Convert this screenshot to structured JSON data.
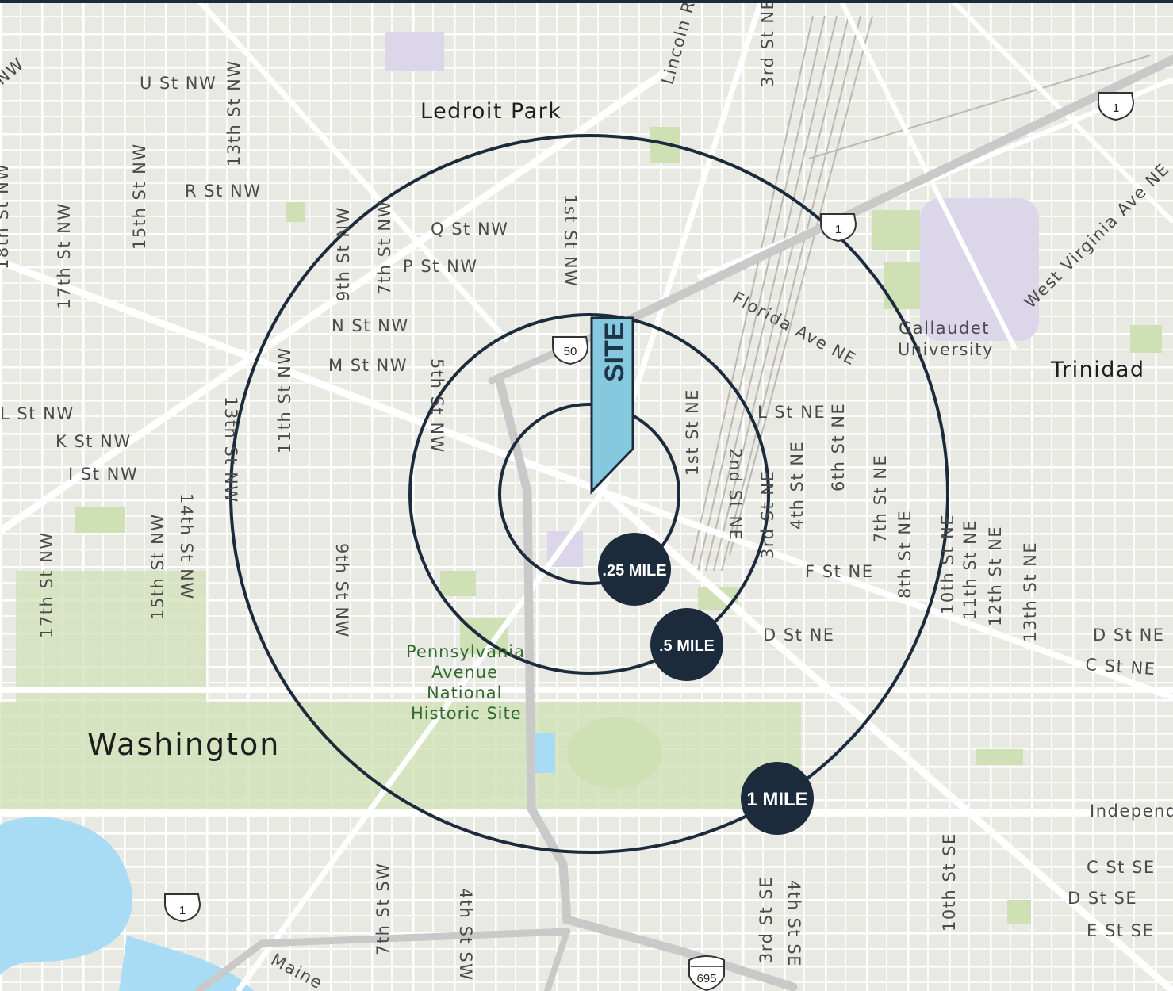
{
  "map": {
    "colors": {
      "land": "#e9e9e4",
      "road": "#ffffff",
      "park": "#cfe0b4",
      "water": "#a8dcf5",
      "ring": "#1c2b3c",
      "badge": "#1c2b3c",
      "site_flag": "#86c8de"
    },
    "site_label": "SITE",
    "rings": [
      {
        "label": ".25 MILE",
        "miles": 0.25
      },
      {
        "label": ".5 MILE",
        "miles": 0.5
      },
      {
        "label": "1 MILE",
        "miles": 1
      }
    ],
    "shields": [
      "1",
      "1",
      "50",
      "1",
      "695"
    ],
    "place_labels": {
      "ledroit_park": "Ledroit Park",
      "trinidad": "Trinidad",
      "washington": "Washington",
      "gallaudet_1": "Gallaudet",
      "gallaudet_2": "University",
      "penn_1": "Pennsylvania",
      "penn_2": "Avenue",
      "penn_3": "National",
      "penn_4": "Historic Site"
    },
    "street_labels": {
      "nw_corner": "NW",
      "u_st": "U St NW",
      "thirteenth_nw_top": "13th St NW",
      "lincoln_rd": "Lincoln Rd",
      "third_ne_top": "3rd St NE",
      "r_st": "R St NW",
      "fifteenth_nw_top": "15th St NW",
      "eighteenth_nw": "18th St NW",
      "seventeenth_nw_top": "17th St NW",
      "q_st": "Q St NW",
      "p_st": "P St NW",
      "ninth_nw_top": "9th St NW",
      "seventh_nw": "7th St NW",
      "first_nw": "1st St NW",
      "n_st": "N St NW",
      "m_st": "M St NW",
      "l_st_nw": "L St NW",
      "k_st_nw": "K St NW",
      "i_st_nw": "I St NW",
      "eleventh_nw": "11th St NW",
      "thirteenth_nw_mid": "13th St NW",
      "fifth_nw": "5th St NW",
      "fourteenth_nw": "14th St NW",
      "fifteenth_nw_bot": "15th St NW",
      "seventeenth_nw_bot": "17th St NW",
      "ninth_nw_bot": "9th St NW",
      "florida_ave": "Florida Ave NE",
      "west_virginia": "West Virginia Ave NE",
      "l_st_ne": "L St NE",
      "first_ne": "1st St NE",
      "second_ne": "2nd St NE",
      "third_ne_mid": "3rd St NE",
      "fourth_ne": "4th St NE",
      "sixth_ne": "6th St NE",
      "seventh_ne": "7th St NE",
      "eighth_ne": "8th St NE",
      "tenth_ne": "10th St NE",
      "eleventh_ne": "11th St NE",
      "twelfth_ne": "12th St NE",
      "thirteenth_ne": "13th St NE",
      "f_st_ne": "F St NE",
      "d_st_ne": "D St NE",
      "d_st_ne_right": "D St NE",
      "c_st_ne": "C St NE",
      "independence": "Independe",
      "c_st_se": "C St SE",
      "d_st_se": "D St SE",
      "e_st_se": "E St SE",
      "seventh_sw": "7th St SW",
      "fourth_sw": "4th St SW",
      "third_se": "3rd St SE",
      "fourth_se": "4th St SE",
      "tenth_se": "10th St SE",
      "maine": "Maine"
    }
  }
}
